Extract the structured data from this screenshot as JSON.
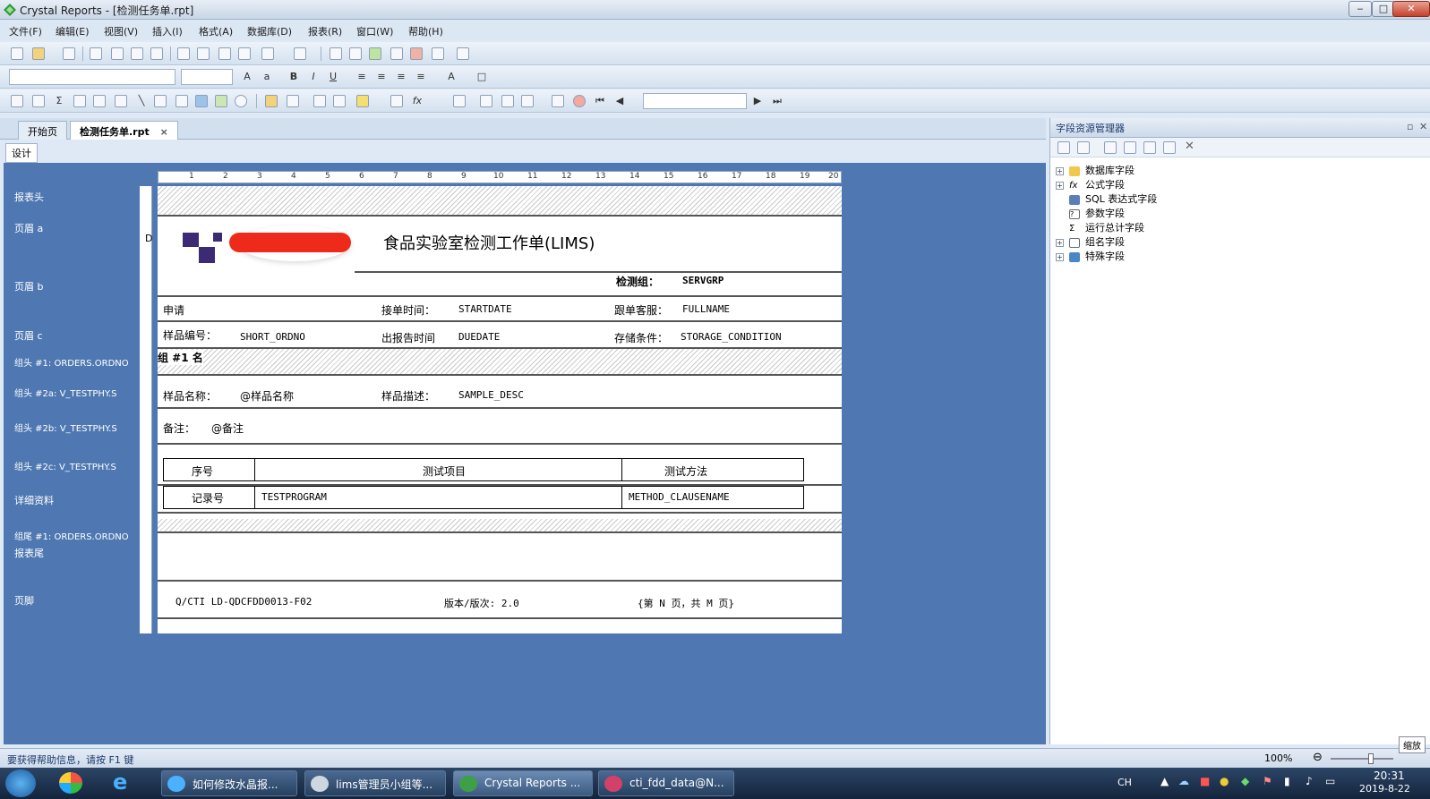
{
  "window": {
    "title": "Crystal Reports - [检测任务单.rpt]"
  },
  "menu": [
    "文件(F)",
    "编辑(E)",
    "视图(V)",
    "插入(I)",
    "格式(A)",
    "数据库(D)",
    "报表(R)",
    "窗口(W)",
    "帮助(H)"
  ],
  "tabs": {
    "start": "开始页",
    "doc": "检测任务单.rpt",
    "close": "×",
    "design": "设计"
  },
  "sections": [
    "报表头",
    "页眉 a",
    "页眉 b",
    "页眉 c",
    "组头 #1: ORDERS.ORDNO",
    "组头 #2a: V_TESTPHY.S",
    "组头 #2b: V_TESTPHY.S",
    "组头 #2c: V_TESTPHY.S",
    "详细资料",
    "组尾 #1: ORDERS.ORDNO",
    "报表尾",
    "页脚"
  ],
  "ruler": [
    "1",
    "2",
    "3",
    "4",
    "5",
    "6",
    "7",
    "8",
    "9",
    "10",
    "11",
    "12",
    "13",
    "14",
    "15",
    "16",
    "17",
    "18",
    "19",
    "20"
  ],
  "report": {
    "title": "食品实验室检测工作单(LIMS)",
    "logo_partial": "D",
    "servgrp_label": "检测组：",
    "servgrp_field": "SERVGRP",
    "client_label_partial": "申请",
    "receive_label": "接单时间：",
    "receive_field": "STARTDATE",
    "cs_label": "跟单客服：",
    "cs_field": "FULLNAME",
    "sample_no_label": "样品编号：",
    "sample_no_field": "SHORT_ORDNO",
    "report_time_label": "出报告时间",
    "report_time_field": "DUEDATE",
    "storage_label": "存储条件：",
    "storage_field": "STORAGE_CONDITION",
    "group_name": "组 #1 名",
    "sample_name_label": "样品名称：",
    "sample_name_field": "@样品名称",
    "sample_desc_label": "样品描述：",
    "sample_desc_field": "SAMPLE_DESC",
    "remark_label": "备注：",
    "remark_field": "@备注",
    "col_seq": "序号",
    "col_item": "测试项目",
    "col_method": "测试方法",
    "row_seq": "记录号",
    "row_item": "TESTPROGRAM",
    "row_method": "METHOD_CLAUSENAME",
    "footer_doc": "Q/CTI LD-QDCFDD0013-F02",
    "footer_version": "版本/版次: 2.0",
    "footer_page": "{第 N 页，共 M 页}"
  },
  "right_panel": {
    "title": "字段资源管理器",
    "items": [
      "数据库字段",
      "公式字段",
      "SQL 表达式字段",
      "参数字段",
      "运行总计字段",
      "组名字段",
      "特殊字段"
    ]
  },
  "status": {
    "help": "要获得帮助信息，请按 F1 键",
    "zoom": "100%",
    "zoom_btn": "缩放"
  },
  "taskbar": {
    "tasks": [
      "如何修改水晶报...",
      "lims管理员小组等...",
      "Crystal Reports ...",
      "cti_fdd_data@N..."
    ],
    "ime": "CH",
    "time": "20:31",
    "date": "2019-8-22"
  },
  "colors": {
    "design_bg": "#4f78b2",
    "panel_bg": "#dfe9f5",
    "taskbar": "#14243c"
  }
}
